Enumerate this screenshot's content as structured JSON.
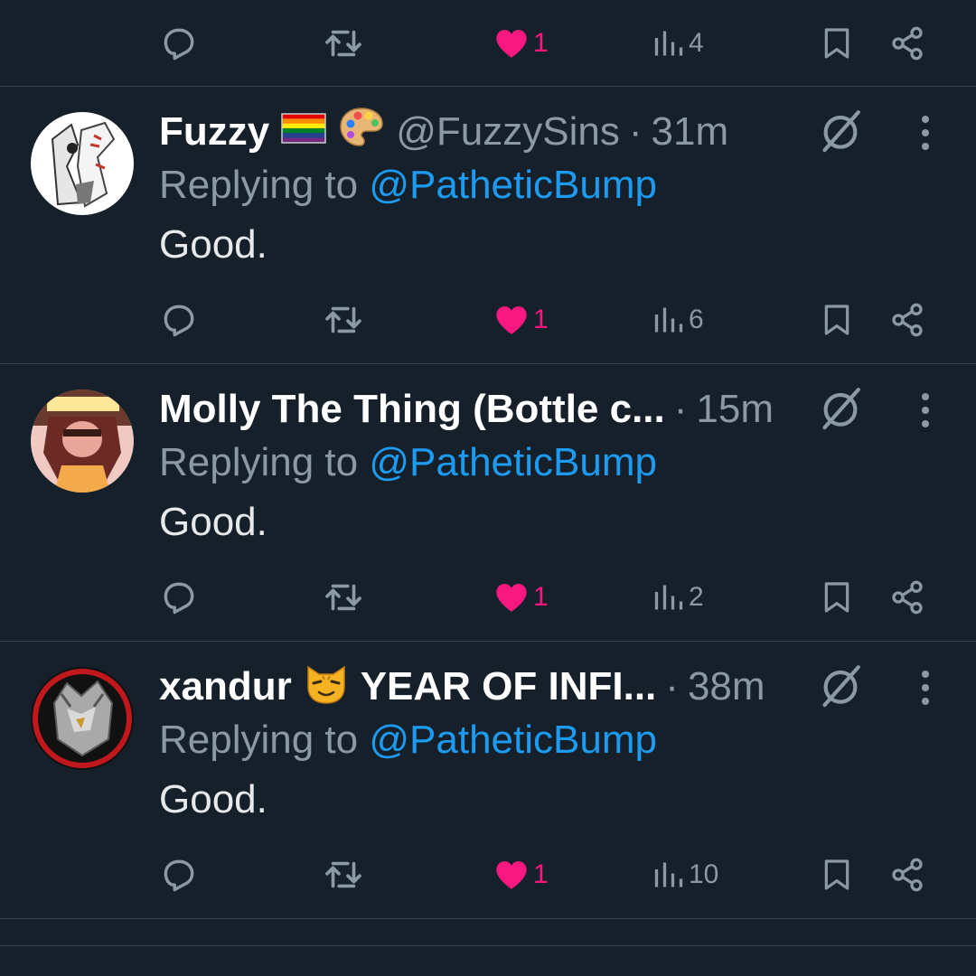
{
  "top_actions": {
    "likes": "1",
    "views": "4"
  },
  "tweets": [
    {
      "name": "Fuzzy",
      "handle": "@FuzzySins",
      "dot": "·",
      "time": "31m",
      "emojis": [
        "rainbow-flag-icon",
        "palette-icon"
      ],
      "replying_prefix": "Replying to",
      "replying_to": "@PatheticBump",
      "text": "Good.",
      "likes": "1",
      "views": "6"
    },
    {
      "name": "Molly The Thing (Bottle c...",
      "handle": "",
      "dot": "·",
      "time": "15m",
      "emojis": [],
      "replying_prefix": "Replying to",
      "replying_to": "@PatheticBump",
      "text": "Good.",
      "likes": "1",
      "views": "2"
    },
    {
      "name": "xandur",
      "name_suffix": "YEAR OF INFI...",
      "handle": "",
      "dot": "·",
      "time": "38m",
      "emojis": [
        "cat-face-icon"
      ],
      "replying_prefix": "Replying to",
      "replying_to": "@PatheticBump",
      "text": "Good.",
      "likes": "1",
      "views": "10"
    }
  ],
  "colors": {
    "background": "#15202b",
    "divider": "#38444d",
    "muted": "#8b98a5",
    "link": "#1d9bf0",
    "like": "#f91880"
  }
}
